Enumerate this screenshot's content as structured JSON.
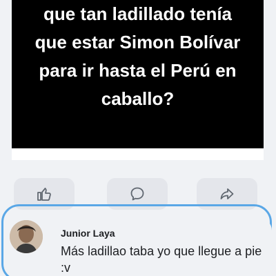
{
  "post": {
    "image_text_lines": [
      "que tan ladillado tenía",
      "que estar Simon Bolívar",
      "para ir hasta el Perú en",
      "caballo?"
    ]
  },
  "actions": {
    "like_icon": "thumbs-up-icon",
    "comment_icon": "comment-bubble-icon",
    "share_icon": "share-arrow-icon"
  },
  "comment": {
    "author": "Junior Laya",
    "text": "Más ladillao taba yo que llegue a pie :v",
    "highlight_color": "#5aa7e6"
  }
}
